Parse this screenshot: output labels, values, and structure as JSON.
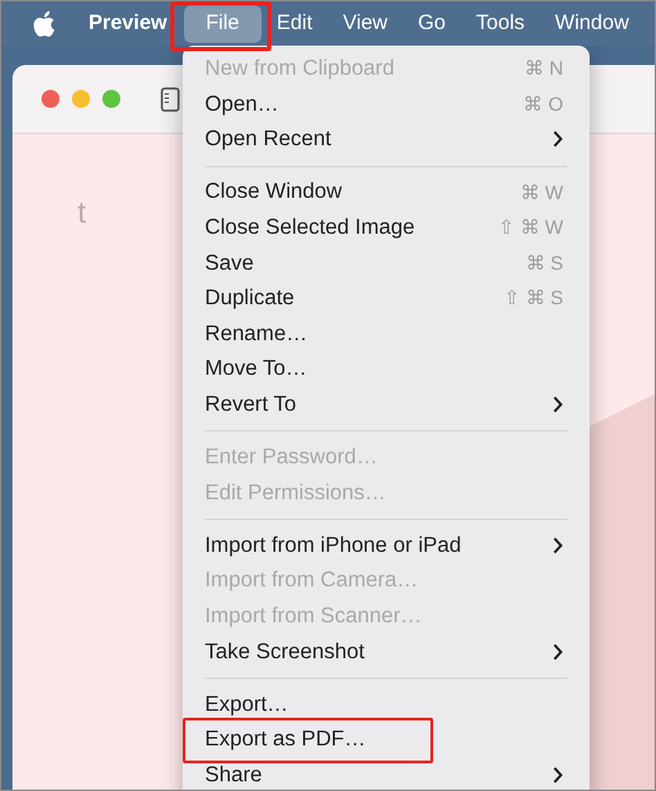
{
  "menu_bar": [
    {
      "label": "Preview",
      "kind": "app",
      "selected": false,
      "annotated": false
    },
    {
      "label": "File",
      "kind": "menu",
      "selected": true,
      "annotated": true
    },
    {
      "label": "Edit",
      "kind": "menu",
      "selected": false,
      "annotated": false
    },
    {
      "label": "View",
      "kind": "menu",
      "selected": false,
      "annotated": false
    },
    {
      "label": "Go",
      "kind": "menu",
      "selected": false,
      "annotated": false
    },
    {
      "label": "Tools",
      "kind": "menu",
      "selected": false,
      "annotated": false
    },
    {
      "label": "Window",
      "kind": "menu",
      "selected": false,
      "annotated": false
    }
  ],
  "document": {
    "texts": [
      "t"
    ]
  },
  "file_menu": [
    {
      "kind": "item",
      "label": "New from Clipboard",
      "shortcut": "⌘ N",
      "disabled": true,
      "submenu": false,
      "annotated": false
    },
    {
      "kind": "item",
      "label": "Open…",
      "shortcut": "⌘ O",
      "disabled": false,
      "submenu": false,
      "annotated": false
    },
    {
      "kind": "item",
      "label": "Open Recent",
      "disabled": false,
      "submenu": true,
      "annotated": false
    },
    {
      "kind": "separator"
    },
    {
      "kind": "item",
      "label": "Close Window",
      "shortcut": "⌘ W",
      "disabled": false,
      "submenu": false,
      "annotated": false
    },
    {
      "kind": "item",
      "label": "Close Selected Image",
      "shortcut": "⇧ ⌘ W",
      "disabled": false,
      "submenu": false,
      "annotated": false
    },
    {
      "kind": "item",
      "label": "Save",
      "shortcut": "⌘ S",
      "disabled": false,
      "submenu": false,
      "annotated": false
    },
    {
      "kind": "item",
      "label": "Duplicate",
      "shortcut": "⇧ ⌘ S",
      "disabled": false,
      "submenu": false,
      "annotated": false
    },
    {
      "kind": "item",
      "label": "Rename…",
      "disabled": false,
      "submenu": false,
      "annotated": false
    },
    {
      "kind": "item",
      "label": "Move To…",
      "disabled": false,
      "submenu": false,
      "annotated": false
    },
    {
      "kind": "item",
      "label": "Revert To",
      "disabled": false,
      "submenu": true,
      "annotated": false
    },
    {
      "kind": "separator"
    },
    {
      "kind": "item",
      "label": "Enter Password…",
      "disabled": true,
      "submenu": false,
      "annotated": false
    },
    {
      "kind": "item",
      "label": "Edit Permissions…",
      "disabled": true,
      "submenu": false,
      "annotated": false
    },
    {
      "kind": "separator"
    },
    {
      "kind": "item",
      "label": "Import from iPhone or iPad",
      "disabled": false,
      "submenu": true,
      "annotated": false
    },
    {
      "kind": "item",
      "label": "Import from Camera…",
      "disabled": true,
      "submenu": false,
      "annotated": false
    },
    {
      "kind": "item",
      "label": "Import from Scanner…",
      "disabled": true,
      "submenu": false,
      "annotated": false
    },
    {
      "kind": "item",
      "label": "Take Screenshot",
      "disabled": false,
      "submenu": true,
      "annotated": false
    },
    {
      "kind": "separator"
    },
    {
      "kind": "item",
      "label": "Export…",
      "disabled": false,
      "submenu": false,
      "annotated": false
    },
    {
      "kind": "item",
      "label": "Export as PDF…",
      "disabled": false,
      "submenu": false,
      "annotated": true
    },
    {
      "kind": "item",
      "label": "Share",
      "disabled": false,
      "submenu": true,
      "annotated": false
    }
  ]
}
